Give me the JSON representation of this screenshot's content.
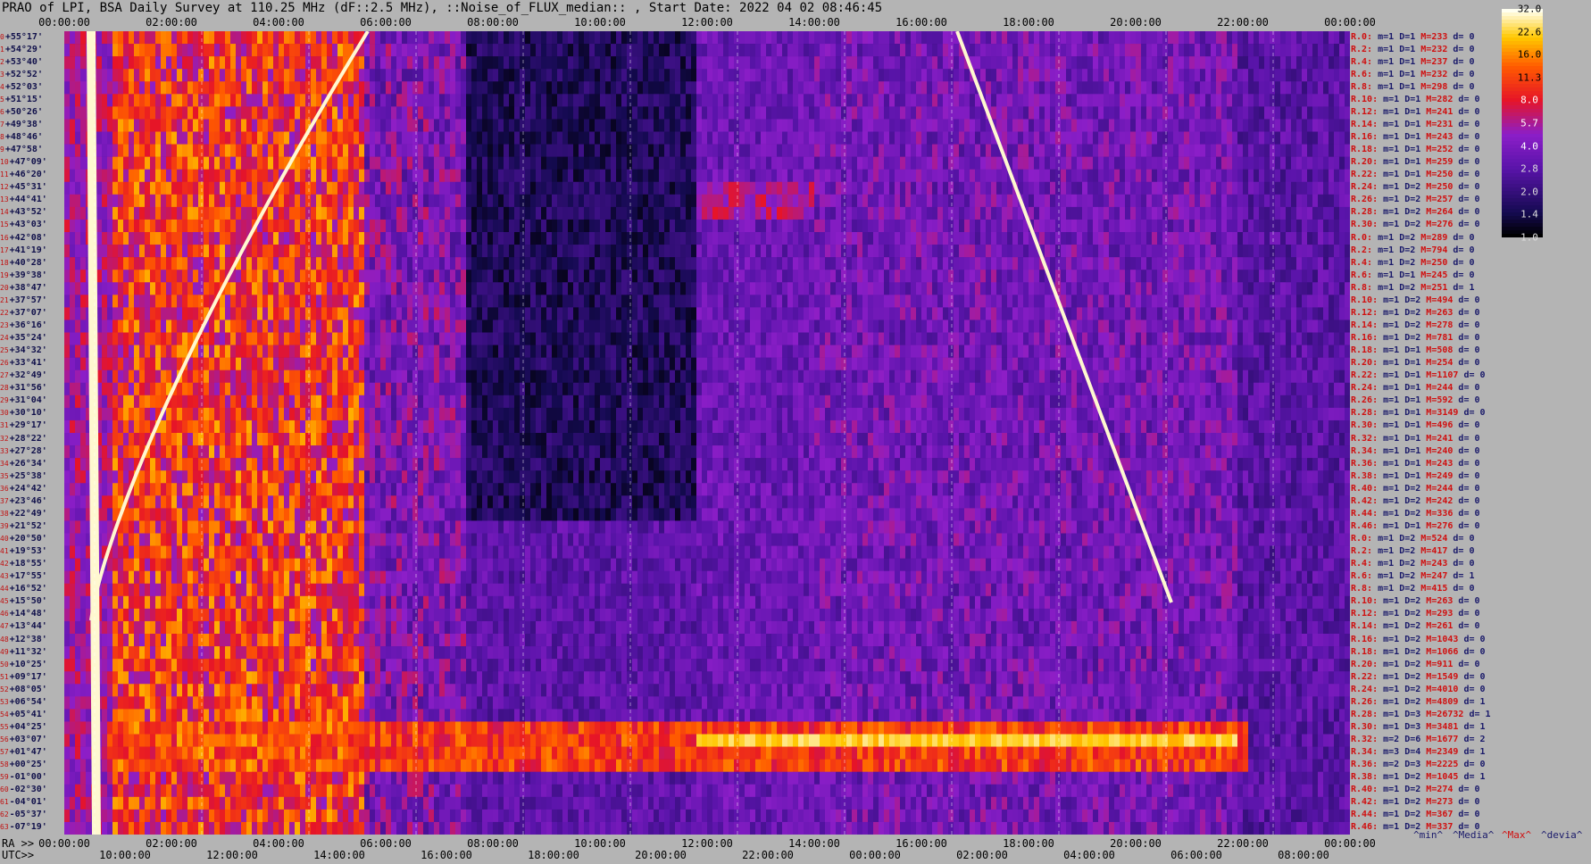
{
  "title": "PRAO of LPI, BSA Daily Survey at 110.25 MHz (dF::2.5 MHz), ::Noise_of_FLUX_median:: , Start Date: 2022 04 02 08:46:45",
  "colors": {
    "bg": "#b4b4b4",
    "index": "#c01010",
    "dec": "#10104a",
    "row_name": "#d01010",
    "stat": "#1a1a6a",
    "legend_red": "#d01010",
    "legend_blue": "#1a1a6a"
  },
  "axes": {
    "top_ticks": [
      "00:00:00",
      "02:00:00",
      "04:00:00",
      "06:00:00",
      "08:00:00",
      "10:00:00",
      "12:00:00",
      "14:00:00",
      "16:00:00",
      "18:00:00",
      "20:00:00",
      "22:00:00",
      "00:00:00"
    ],
    "ra_label": "RA >>",
    "ra_ticks": [
      "00:00:00",
      "02:00:00",
      "04:00:00",
      "06:00:00",
      "08:00:00",
      "10:00:00",
      "12:00:00",
      "14:00:00",
      "16:00:00",
      "18:00:00",
      "20:00:00",
      "22:00:00",
      "00:00:00"
    ],
    "utc_label": "UTC>>",
    "utc_ticks": [
      "10:00:00",
      "12:00:00",
      "14:00:00",
      "16:00:00",
      "18:00:00",
      "20:00:00",
      "22:00:00",
      "00:00:00",
      "02:00:00",
      "04:00:00",
      "06:00:00",
      "08:00:00"
    ]
  },
  "colorbar": {
    "ticks": [
      "32.0",
      "22.6",
      "16.0",
      "11.3",
      "8.0",
      "5.7",
      "4.0",
      "2.8",
      "2.0",
      "1.4",
      "1.0"
    ]
  },
  "legend": {
    "min": "^min^",
    "median": "^Media^",
    "max": "^Max^",
    "dev": "^devia^"
  },
  "chart_data": {
    "type": "heatmap",
    "title": "PRAO of LPI, BSA Daily Survey at 110.25 MHz (dF::2.5 MHz), ::Noise_of_FLUX_median:: , Start Date: 2022 04 02 08:46:45",
    "x_axis": "RA 00:00:00 to 24:00:00 (UTC 08:46:45 to 08:46:45 next day)",
    "colorbar_range": [
      1.0,
      32.0
    ],
    "colorbar_scale": "log",
    "rows": [
      {
        "idx": "0",
        "dec": "+55°17'",
        "stat": {
          "r": "R.0:",
          "m": "1",
          "D": "1",
          "M": "233",
          "d": "0"
        }
      },
      {
        "idx": "1",
        "dec": "+54°29'",
        "stat": {
          "r": "R.2:",
          "m": "1",
          "D": "1",
          "M": "232",
          "d": "0"
        }
      },
      {
        "idx": "2",
        "dec": "+53°40'",
        "stat": {
          "r": "R.4:",
          "m": "1",
          "D": "1",
          "M": "237",
          "d": "0"
        }
      },
      {
        "idx": "3",
        "dec": "+52°52'",
        "stat": {
          "r": "R.6:",
          "m": "1",
          "D": "1",
          "M": "232",
          "d": "0"
        }
      },
      {
        "idx": "4",
        "dec": "+52°03'",
        "stat": {
          "r": "R.8:",
          "m": "1",
          "D": "1",
          "M": "298",
          "d": "0"
        }
      },
      {
        "idx": "5",
        "dec": "+51°15'",
        "stat": {
          "r": "R.10:",
          "m": "1",
          "D": "1",
          "M": "282",
          "d": "0"
        }
      },
      {
        "idx": "6",
        "dec": "+50°26'",
        "stat": {
          "r": "R.12:",
          "m": "1",
          "D": "1",
          "M": "241",
          "d": "0"
        }
      },
      {
        "idx": "7",
        "dec": "+49°38'",
        "stat": {
          "r": "R.14:",
          "m": "1",
          "D": "1",
          "M": "231",
          "d": "0"
        }
      },
      {
        "idx": "8",
        "dec": "+48°46'",
        "stat": {
          "r": "R.16:",
          "m": "1",
          "D": "1",
          "M": "243",
          "d": "0"
        }
      },
      {
        "idx": "9",
        "dec": "+47°58'",
        "stat": {
          "r": "R.18:",
          "m": "1",
          "D": "1",
          "M": "252",
          "d": "0"
        }
      },
      {
        "idx": "10",
        "dec": "+47°09'",
        "stat": {
          "r": "R.20:",
          "m": "1",
          "D": "1",
          "M": "259",
          "d": "0"
        }
      },
      {
        "idx": "11",
        "dec": "+46°20'",
        "stat": {
          "r": "R.22:",
          "m": "1",
          "D": "1",
          "M": "250",
          "d": "0"
        }
      },
      {
        "idx": "12",
        "dec": "+45°31'",
        "stat": {
          "r": "R.24:",
          "m": "1",
          "D": "2",
          "M": "250",
          "d": "0"
        }
      },
      {
        "idx": "13",
        "dec": "+44°41'",
        "stat": {
          "r": "R.26:",
          "m": "1",
          "D": "2",
          "M": "257",
          "d": "0"
        }
      },
      {
        "idx": "14",
        "dec": "+43°52'",
        "stat": {
          "r": "R.28:",
          "m": "1",
          "D": "2",
          "M": "264",
          "d": "0"
        }
      },
      {
        "idx": "15",
        "dec": "+43°03'",
        "stat": {
          "r": "R.30:",
          "m": "1",
          "D": "2",
          "M": "276",
          "d": "0"
        }
      },
      {
        "idx": "16",
        "dec": "+42°08'",
        "stat": {
          "r": "R.0:",
          "m": "1",
          "D": "2",
          "M": "289",
          "d": "0"
        }
      },
      {
        "idx": "17",
        "dec": "+41°19'",
        "stat": {
          "r": "R.2:",
          "m": "1",
          "D": "2",
          "M": "794",
          "d": "0"
        }
      },
      {
        "idx": "18",
        "dec": "+40°28'",
        "stat": {
          "r": "R.4:",
          "m": "1",
          "D": "2",
          "M": "250",
          "d": "0"
        }
      },
      {
        "idx": "19",
        "dec": "+39°38'",
        "stat": {
          "r": "R.6:",
          "m": "1",
          "D": "1",
          "M": "245",
          "d": "0"
        }
      },
      {
        "idx": "20",
        "dec": "+38°47'",
        "stat": {
          "r": "R.8:",
          "m": "1",
          "D": "2",
          "M": "251",
          "d": "1"
        }
      },
      {
        "idx": "21",
        "dec": "+37°57'",
        "stat": {
          "r": "R.10:",
          "m": "1",
          "D": "2",
          "M": "494",
          "d": "0"
        }
      },
      {
        "idx": "22",
        "dec": "+37°07'",
        "stat": {
          "r": "R.12:",
          "m": "1",
          "D": "2",
          "M": "263",
          "d": "0"
        }
      },
      {
        "idx": "23",
        "dec": "+36°16'",
        "stat": {
          "r": "R.14:",
          "m": "1",
          "D": "2",
          "M": "278",
          "d": "0"
        }
      },
      {
        "idx": "24",
        "dec": "+35°24'",
        "stat": {
          "r": "R.16:",
          "m": "1",
          "D": "2",
          "M": "781",
          "d": "0"
        }
      },
      {
        "idx": "25",
        "dec": "+34°32'",
        "stat": {
          "r": "R.18:",
          "m": "1",
          "D": "1",
          "M": "508",
          "d": "0"
        }
      },
      {
        "idx": "26",
        "dec": "+33°41'",
        "stat": {
          "r": "R.20:",
          "m": "1",
          "D": "1",
          "M": "254",
          "d": "0"
        }
      },
      {
        "idx": "27",
        "dec": "+32°49'",
        "stat": {
          "r": "R.22:",
          "m": "1",
          "D": "1",
          "M": "1107",
          "d": "0"
        }
      },
      {
        "idx": "28",
        "dec": "+31°56'",
        "stat": {
          "r": "R.24:",
          "m": "1",
          "D": "1",
          "M": "244",
          "d": "0"
        }
      },
      {
        "idx": "29",
        "dec": "+31°04'",
        "stat": {
          "r": "R.26:",
          "m": "1",
          "D": "1",
          "M": "592",
          "d": "0"
        }
      },
      {
        "idx": "30",
        "dec": "+30°10'",
        "stat": {
          "r": "R.28:",
          "m": "1",
          "D": "1",
          "M": "3149",
          "d": "0"
        }
      },
      {
        "idx": "31",
        "dec": "+29°17'",
        "stat": {
          "r": "R.30:",
          "m": "1",
          "D": "1",
          "M": "496",
          "d": "0"
        }
      },
      {
        "idx": "32",
        "dec": "+28°22'",
        "stat": {
          "r": "R.32:",
          "m": "1",
          "D": "1",
          "M": "241",
          "d": "0"
        }
      },
      {
        "idx": "33",
        "dec": "+27°28'",
        "stat": {
          "r": "R.34:",
          "m": "1",
          "D": "1",
          "M": "240",
          "d": "0"
        }
      },
      {
        "idx": "34",
        "dec": "+26°34'",
        "stat": {
          "r": "R.36:",
          "m": "1",
          "D": "1",
          "M": "243",
          "d": "0"
        }
      },
      {
        "idx": "35",
        "dec": "+25°38'",
        "stat": {
          "r": "R.38:",
          "m": "1",
          "D": "1",
          "M": "249",
          "d": "0"
        }
      },
      {
        "idx": "36",
        "dec": "+24°42'",
        "stat": {
          "r": "R.40:",
          "m": "1",
          "D": "2",
          "M": "244",
          "d": "0"
        }
      },
      {
        "idx": "37",
        "dec": "+23°46'",
        "stat": {
          "r": "R.42:",
          "m": "1",
          "D": "2",
          "M": "242",
          "d": "0"
        }
      },
      {
        "idx": "38",
        "dec": "+22°49'",
        "stat": {
          "r": "R.44:",
          "m": "1",
          "D": "2",
          "M": "336",
          "d": "0"
        }
      },
      {
        "idx": "39",
        "dec": "+21°52'",
        "stat": {
          "r": "R.46:",
          "m": "1",
          "D": "1",
          "M": "276",
          "d": "0"
        }
      },
      {
        "idx": "40",
        "dec": "+20°50'",
        "stat": {
          "r": "R.0:",
          "m": "1",
          "D": "2",
          "M": "524",
          "d": "0"
        }
      },
      {
        "idx": "41",
        "dec": "+19°53'",
        "stat": {
          "r": "R.2:",
          "m": "1",
          "D": "2",
          "M": "417",
          "d": "0"
        }
      },
      {
        "idx": "42",
        "dec": "+18°55'",
        "stat": {
          "r": "R.4:",
          "m": "1",
          "D": "2",
          "M": "243",
          "d": "0"
        }
      },
      {
        "idx": "43",
        "dec": "+17°55'",
        "stat": {
          "r": "R.6:",
          "m": "1",
          "D": "2",
          "M": "247",
          "d": "1"
        }
      },
      {
        "idx": "44",
        "dec": "+16°52'",
        "stat": {
          "r": "R.8:",
          "m": "1",
          "D": "2",
          "M": "415",
          "d": "0"
        }
      },
      {
        "idx": "45",
        "dec": "+15°50'",
        "stat": {
          "r": "R.10:",
          "m": "1",
          "D": "2",
          "M": "263",
          "d": "0"
        }
      },
      {
        "idx": "46",
        "dec": "+14°48'",
        "stat": {
          "r": "R.12:",
          "m": "1",
          "D": "2",
          "M": "293",
          "d": "0"
        }
      },
      {
        "idx": "47",
        "dec": "+13°44'",
        "stat": {
          "r": "R.14:",
          "m": "1",
          "D": "2",
          "M": "261",
          "d": "0"
        }
      },
      {
        "idx": "48",
        "dec": "+12°38'",
        "stat": {
          "r": "R.16:",
          "m": "1",
          "D": "2",
          "M": "1043",
          "d": "0"
        }
      },
      {
        "idx": "49",
        "dec": "+11°32'",
        "stat": {
          "r": "R.18:",
          "m": "1",
          "D": "2",
          "M": "1066",
          "d": "0"
        }
      },
      {
        "idx": "50",
        "dec": "+10°25'",
        "stat": {
          "r": "R.20:",
          "m": "1",
          "D": "2",
          "M": "911",
          "d": "0"
        }
      },
      {
        "idx": "51",
        "dec": "+09°17'",
        "stat": {
          "r": "R.22:",
          "m": "1",
          "D": "2",
          "M": "1549",
          "d": "0"
        }
      },
      {
        "idx": "52",
        "dec": "+08°05'",
        "stat": {
          "r": "R.24:",
          "m": "1",
          "D": "2",
          "M": "4010",
          "d": "0"
        }
      },
      {
        "idx": "53",
        "dec": "+06°54'",
        "stat": {
          "r": "R.26:",
          "m": "1",
          "D": "2",
          "M": "4809",
          "d": "1"
        }
      },
      {
        "idx": "54",
        "dec": "+05°41'",
        "stat": {
          "r": "R.28:",
          "m": "1",
          "D": "3",
          "M": "26732",
          "d": "1"
        }
      },
      {
        "idx": "55",
        "dec": "+04°25'",
        "stat": {
          "r": "R.30:",
          "m": "1",
          "D": "3",
          "M": "3481",
          "d": "1"
        }
      },
      {
        "idx": "56",
        "dec": "+03°07'",
        "stat": {
          "r": "R.32:",
          "m": "2",
          "D": "6",
          "M": "1677",
          "d": "2"
        }
      },
      {
        "idx": "57",
        "dec": "+01°47'",
        "stat": {
          "r": "R.34:",
          "m": "3",
          "D": "4",
          "M": "2349",
          "d": "1"
        }
      },
      {
        "idx": "58",
        "dec": "+00°25'",
        "stat": {
          "r": "R.36:",
          "m": "2",
          "D": "3",
          "M": "2225",
          "d": "0"
        }
      },
      {
        "idx": "59",
        "dec": "-01°00'",
        "stat": {
          "r": "R.38:",
          "m": "1",
          "D": "2",
          "M": "1045",
          "d": "1"
        }
      },
      {
        "idx": "60",
        "dec": "-02°30'",
        "stat": {
          "r": "R.40:",
          "m": "1",
          "D": "2",
          "M": "274",
          "d": "0"
        }
      },
      {
        "idx": "61",
        "dec": "-04°01'",
        "stat": {
          "r": "R.42:",
          "m": "1",
          "D": "2",
          "M": "273",
          "d": "0"
        }
      },
      {
        "idx": "62",
        "dec": "-05°37'",
        "stat": {
          "r": "R.44:",
          "m": "1",
          "D": "2",
          "M": "367",
          "d": "0"
        }
      },
      {
        "idx": "63",
        "dec": "-07°19'",
        "stat": {
          "r": "R.46:",
          "m": "1",
          "D": "2",
          "M": "337",
          "d": "0"
        }
      }
    ]
  }
}
